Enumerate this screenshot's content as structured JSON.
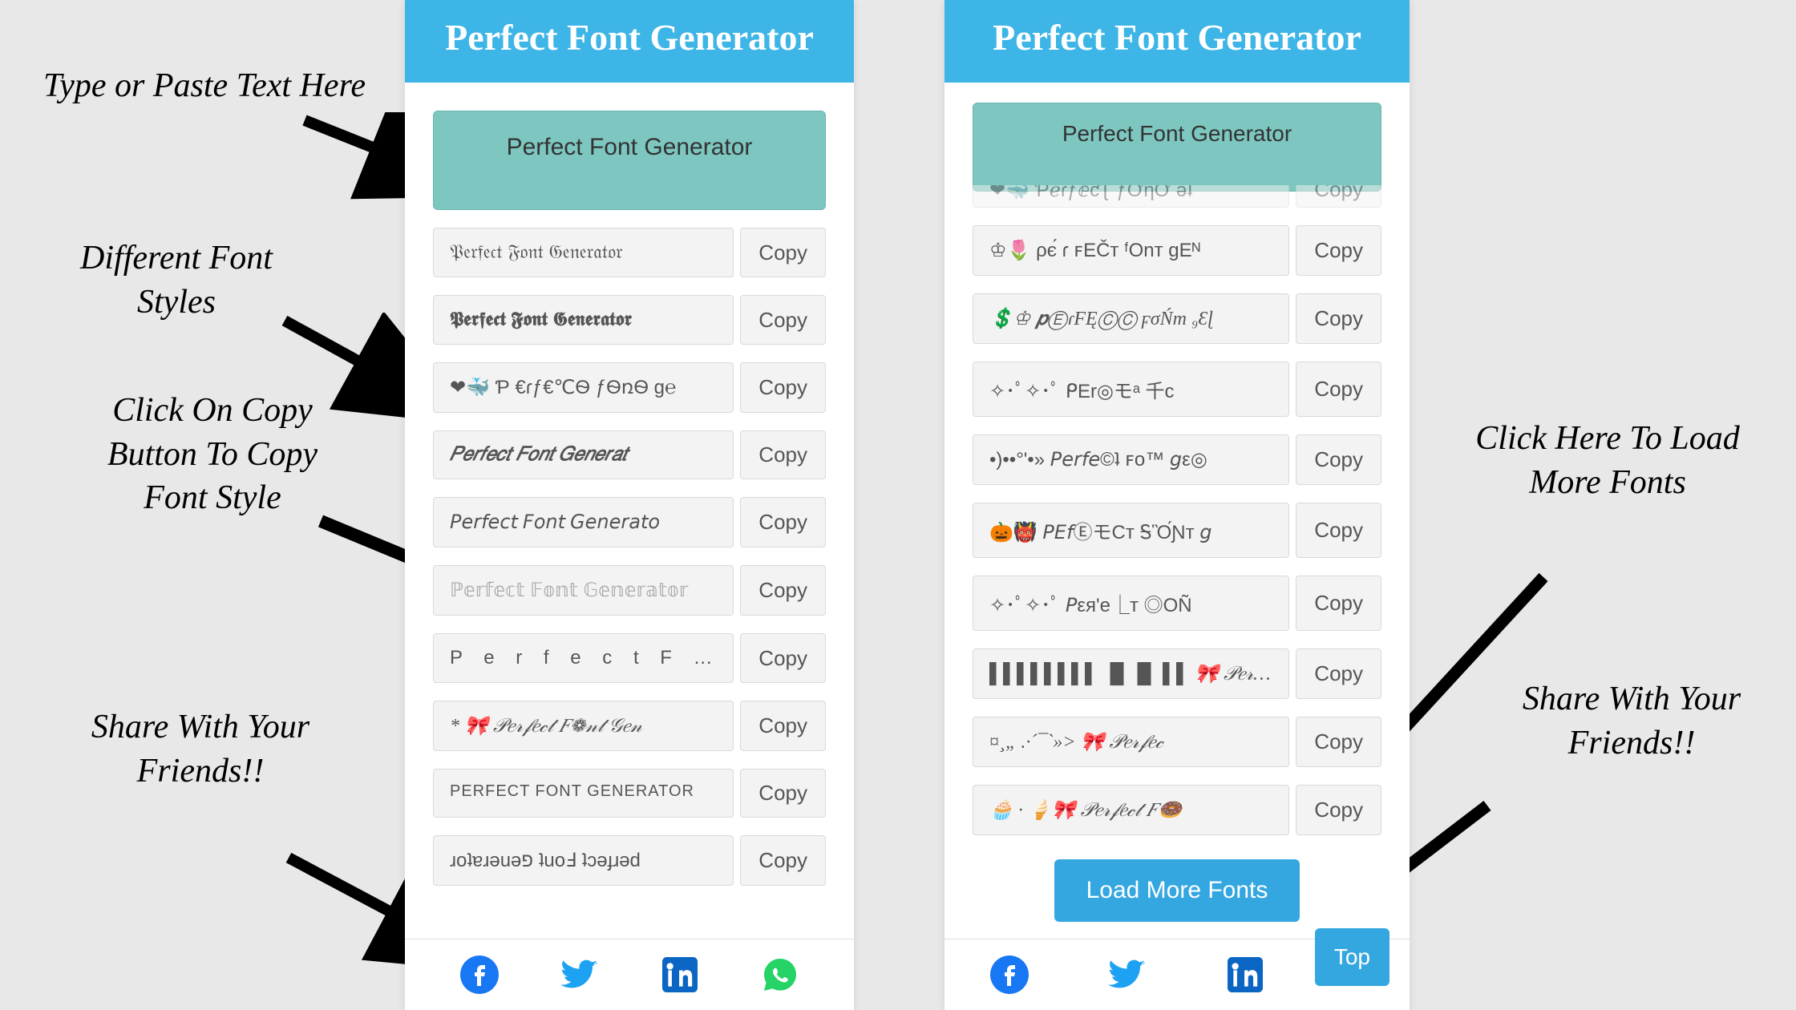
{
  "annotations": {
    "type_here": "Type or Paste Text Here",
    "different_styles": "Different Font Styles",
    "click_copy": "Click On Copy Button To Copy Font Style",
    "share_left": "Share With Your Friends!!",
    "click_load_more": "Click Here To Load More Fonts",
    "share_right": "Share With Your Friends!!"
  },
  "left_panel": {
    "header": "Perfect Font Generator",
    "input_value": "Perfect Font Generator",
    "rows": [
      {
        "text": "𝔓𝔢𝔯𝔣𝔢𝔠𝔱 𝔉𝔬𝔫𝔱 𝔊𝔢𝔫𝔢𝔯𝔞𝔱𝔬𝔯"
      },
      {
        "text": "𝕻𝖊𝖗𝖋𝖊𝖈𝖙 𝕱𝖔𝖓𝖙 𝕲𝖊𝖓𝖊𝖗𝖆𝖙𝖔𝖗"
      },
      {
        "text": "❤🐳 Ƥ €ɾƒ€℃Ѳ ƒѲռѲ ɡ℮"
      },
      {
        "text": "𝑃𝑒𝑟𝑓𝑒𝑐𝑡 𝐹𝑜𝑛𝑡 𝐺𝑒𝑛𝑒𝑟𝑎𝑡"
      },
      {
        "text": "𝘗𝘦𝘳𝘧𝘦𝘤𝘵 𝘍𝘰𝘯𝘵 𝘎𝘦𝘯𝘦𝘳𝘢𝘵𝘰"
      },
      {
        "text": "ℙ𝕖𝕣𝕗𝕖𝕔𝕥 𝔽𝕠𝕟𝕥 𝔾𝕖𝕟𝕖𝕣𝕒𝕥𝕠𝕣"
      },
      {
        "text": "P e r f e c t  F o n t"
      },
      {
        "text": "* 🎀 𝒫𝑒𝓇𝒻𝑒𝒸𝓉 𝐹❁𝓃𝓉 𝒢𝑒𝓃"
      },
      {
        "text": "PERFECT FONT GENERATOR"
      },
      {
        "text": "ɹoʇɐɹǝuǝפ ʇuoℲ ʇɔǝɟɹǝd"
      }
    ],
    "copy_label": "Copy"
  },
  "right_panel": {
    "header": "Perfect Font Generator",
    "input_value": "Perfect Font Generator",
    "cutoff_row": "❤🐳 ƤℯɾƒⅇƈƮ ƒƠƞƠ ǝʇ",
    "rows": [
      {
        "text": "♔🌷  ρє́ ɾ ꜰEČᴛ ᶠOnᴛ gEᴺ"
      },
      {
        "text": "💲♔  𝒑ⒺɾFĘⒸⒸ ϝσŃт ₉Ɛɭ"
      },
      {
        "text": "✧･ﾟ✧･ﾟ  ᑭEr◎モᵃ 千c"
      },
      {
        "text": "•)••°'•» 𝘗𝘦𝘳𝘧𝘦©ʇ ꜰo™ 𝘨ε◎"
      },
      {
        "text": "🎃👹  𝘗𝘌𝘧ⒺモCт ᎦὋ́Ɲт 𝘨"
      },
      {
        "text": "✧･ﾟ✧･ﾟ 𝘗εя'е⎿т ◎OÑ"
      },
      {
        "text": "▌▌▌▌▌▌▌▌ ▐▌▐▌ ▌▌ 🎀 𝒫𝑒𝓇𝒻𝑒𝒸"
      },
      {
        "text": "¤¸„ .·´¯`»> 🎀 𝒫𝑒𝓇𝒻𝑒𝒸"
      },
      {
        "text": "🧁 · 🍦🎀 𝒫𝑒𝓇𝒻𝑒𝒸𝓉 𝐹🍩"
      }
    ],
    "copy_label": "Copy",
    "load_more_label": "Load More Fonts",
    "top_label": "Top"
  },
  "colors": {
    "header_blue": "#3db5e6",
    "input_teal": "#7dc7c0",
    "button_blue": "#35a7e0",
    "facebook": "#1877f2",
    "twitter": "#1da1f2",
    "linkedin": "#0a66c2",
    "whatsapp": "#25d366"
  }
}
